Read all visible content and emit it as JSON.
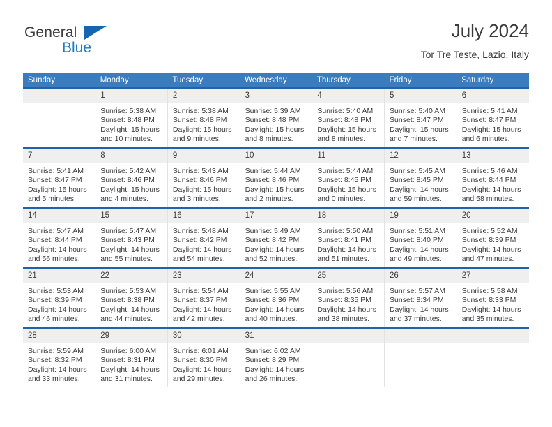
{
  "brand": {
    "name_part1": "General",
    "name_part2": "Blue",
    "triangle_color": "#1565b0",
    "blue_color": "#1f7bc4"
  },
  "header": {
    "title": "July 2024",
    "location": "Tor Tre Teste, Lazio, Italy"
  },
  "theme": {
    "header_bg": "#3a7cbe",
    "row_top_border": "#1f63a8",
    "daynum_bg": "#efefef",
    "text": "#3a3a3a"
  },
  "weekdays": [
    "Sunday",
    "Monday",
    "Tuesday",
    "Wednesday",
    "Thursday",
    "Friday",
    "Saturday"
  ],
  "weeks": [
    [
      {
        "day": "",
        "sunrise": "",
        "sunset": "",
        "daylight_1": "",
        "daylight_2": ""
      },
      {
        "day": "1",
        "sunrise": "Sunrise: 5:38 AM",
        "sunset": "Sunset: 8:48 PM",
        "daylight_1": "Daylight: 15 hours",
        "daylight_2": "and 10 minutes."
      },
      {
        "day": "2",
        "sunrise": "Sunrise: 5:38 AM",
        "sunset": "Sunset: 8:48 PM",
        "daylight_1": "Daylight: 15 hours",
        "daylight_2": "and 9 minutes."
      },
      {
        "day": "3",
        "sunrise": "Sunrise: 5:39 AM",
        "sunset": "Sunset: 8:48 PM",
        "daylight_1": "Daylight: 15 hours",
        "daylight_2": "and 8 minutes."
      },
      {
        "day": "4",
        "sunrise": "Sunrise: 5:40 AM",
        "sunset": "Sunset: 8:48 PM",
        "daylight_1": "Daylight: 15 hours",
        "daylight_2": "and 8 minutes."
      },
      {
        "day": "5",
        "sunrise": "Sunrise: 5:40 AM",
        "sunset": "Sunset: 8:47 PM",
        "daylight_1": "Daylight: 15 hours",
        "daylight_2": "and 7 minutes."
      },
      {
        "day": "6",
        "sunrise": "Sunrise: 5:41 AM",
        "sunset": "Sunset: 8:47 PM",
        "daylight_1": "Daylight: 15 hours",
        "daylight_2": "and 6 minutes."
      }
    ],
    [
      {
        "day": "7",
        "sunrise": "Sunrise: 5:41 AM",
        "sunset": "Sunset: 8:47 PM",
        "daylight_1": "Daylight: 15 hours",
        "daylight_2": "and 5 minutes."
      },
      {
        "day": "8",
        "sunrise": "Sunrise: 5:42 AM",
        "sunset": "Sunset: 8:46 PM",
        "daylight_1": "Daylight: 15 hours",
        "daylight_2": "and 4 minutes."
      },
      {
        "day": "9",
        "sunrise": "Sunrise: 5:43 AM",
        "sunset": "Sunset: 8:46 PM",
        "daylight_1": "Daylight: 15 hours",
        "daylight_2": "and 3 minutes."
      },
      {
        "day": "10",
        "sunrise": "Sunrise: 5:44 AM",
        "sunset": "Sunset: 8:46 PM",
        "daylight_1": "Daylight: 15 hours",
        "daylight_2": "and 2 minutes."
      },
      {
        "day": "11",
        "sunrise": "Sunrise: 5:44 AM",
        "sunset": "Sunset: 8:45 PM",
        "daylight_1": "Daylight: 15 hours",
        "daylight_2": "and 0 minutes."
      },
      {
        "day": "12",
        "sunrise": "Sunrise: 5:45 AM",
        "sunset": "Sunset: 8:45 PM",
        "daylight_1": "Daylight: 14 hours",
        "daylight_2": "and 59 minutes."
      },
      {
        "day": "13",
        "sunrise": "Sunrise: 5:46 AM",
        "sunset": "Sunset: 8:44 PM",
        "daylight_1": "Daylight: 14 hours",
        "daylight_2": "and 58 minutes."
      }
    ],
    [
      {
        "day": "14",
        "sunrise": "Sunrise: 5:47 AM",
        "sunset": "Sunset: 8:44 PM",
        "daylight_1": "Daylight: 14 hours",
        "daylight_2": "and 56 minutes."
      },
      {
        "day": "15",
        "sunrise": "Sunrise: 5:47 AM",
        "sunset": "Sunset: 8:43 PM",
        "daylight_1": "Daylight: 14 hours",
        "daylight_2": "and 55 minutes."
      },
      {
        "day": "16",
        "sunrise": "Sunrise: 5:48 AM",
        "sunset": "Sunset: 8:42 PM",
        "daylight_1": "Daylight: 14 hours",
        "daylight_2": "and 54 minutes."
      },
      {
        "day": "17",
        "sunrise": "Sunrise: 5:49 AM",
        "sunset": "Sunset: 8:42 PM",
        "daylight_1": "Daylight: 14 hours",
        "daylight_2": "and 52 minutes."
      },
      {
        "day": "18",
        "sunrise": "Sunrise: 5:50 AM",
        "sunset": "Sunset: 8:41 PM",
        "daylight_1": "Daylight: 14 hours",
        "daylight_2": "and 51 minutes."
      },
      {
        "day": "19",
        "sunrise": "Sunrise: 5:51 AM",
        "sunset": "Sunset: 8:40 PM",
        "daylight_1": "Daylight: 14 hours",
        "daylight_2": "and 49 minutes."
      },
      {
        "day": "20",
        "sunrise": "Sunrise: 5:52 AM",
        "sunset": "Sunset: 8:39 PM",
        "daylight_1": "Daylight: 14 hours",
        "daylight_2": "and 47 minutes."
      }
    ],
    [
      {
        "day": "21",
        "sunrise": "Sunrise: 5:53 AM",
        "sunset": "Sunset: 8:39 PM",
        "daylight_1": "Daylight: 14 hours",
        "daylight_2": "and 46 minutes."
      },
      {
        "day": "22",
        "sunrise": "Sunrise: 5:53 AM",
        "sunset": "Sunset: 8:38 PM",
        "daylight_1": "Daylight: 14 hours",
        "daylight_2": "and 44 minutes."
      },
      {
        "day": "23",
        "sunrise": "Sunrise: 5:54 AM",
        "sunset": "Sunset: 8:37 PM",
        "daylight_1": "Daylight: 14 hours",
        "daylight_2": "and 42 minutes."
      },
      {
        "day": "24",
        "sunrise": "Sunrise: 5:55 AM",
        "sunset": "Sunset: 8:36 PM",
        "daylight_1": "Daylight: 14 hours",
        "daylight_2": "and 40 minutes."
      },
      {
        "day": "25",
        "sunrise": "Sunrise: 5:56 AM",
        "sunset": "Sunset: 8:35 PM",
        "daylight_1": "Daylight: 14 hours",
        "daylight_2": "and 38 minutes."
      },
      {
        "day": "26",
        "sunrise": "Sunrise: 5:57 AM",
        "sunset": "Sunset: 8:34 PM",
        "daylight_1": "Daylight: 14 hours",
        "daylight_2": "and 37 minutes."
      },
      {
        "day": "27",
        "sunrise": "Sunrise: 5:58 AM",
        "sunset": "Sunset: 8:33 PM",
        "daylight_1": "Daylight: 14 hours",
        "daylight_2": "and 35 minutes."
      }
    ],
    [
      {
        "day": "28",
        "sunrise": "Sunrise: 5:59 AM",
        "sunset": "Sunset: 8:32 PM",
        "daylight_1": "Daylight: 14 hours",
        "daylight_2": "and 33 minutes."
      },
      {
        "day": "29",
        "sunrise": "Sunrise: 6:00 AM",
        "sunset": "Sunset: 8:31 PM",
        "daylight_1": "Daylight: 14 hours",
        "daylight_2": "and 31 minutes."
      },
      {
        "day": "30",
        "sunrise": "Sunrise: 6:01 AM",
        "sunset": "Sunset: 8:30 PM",
        "daylight_1": "Daylight: 14 hours",
        "daylight_2": "and 29 minutes."
      },
      {
        "day": "31",
        "sunrise": "Sunrise: 6:02 AM",
        "sunset": "Sunset: 8:29 PM",
        "daylight_1": "Daylight: 14 hours",
        "daylight_2": "and 26 minutes."
      },
      {
        "day": "",
        "sunrise": "",
        "sunset": "",
        "daylight_1": "",
        "daylight_2": ""
      },
      {
        "day": "",
        "sunrise": "",
        "sunset": "",
        "daylight_1": "",
        "daylight_2": ""
      },
      {
        "day": "",
        "sunrise": "",
        "sunset": "",
        "daylight_1": "",
        "daylight_2": ""
      }
    ]
  ]
}
